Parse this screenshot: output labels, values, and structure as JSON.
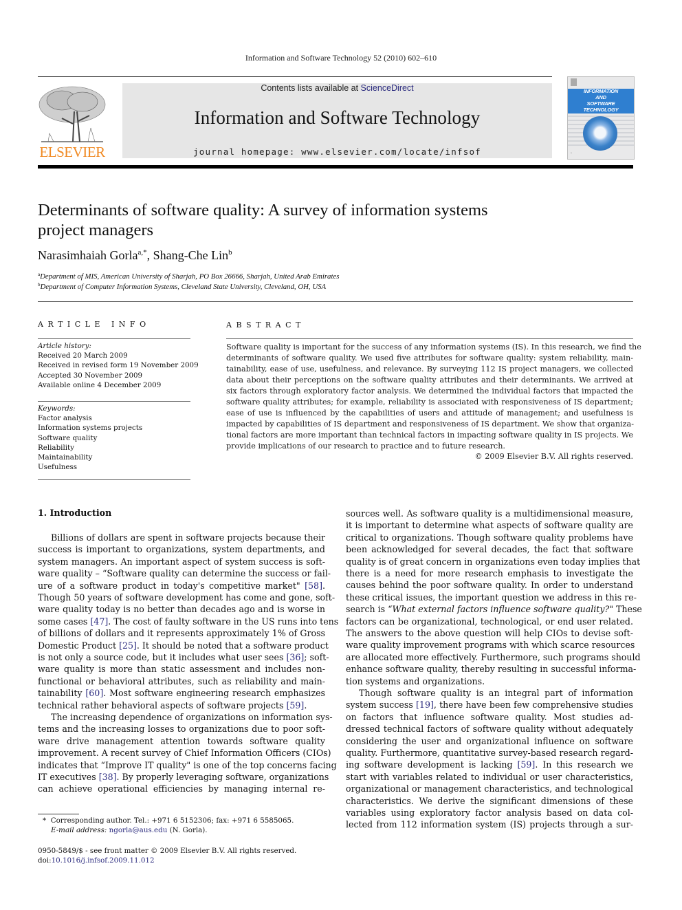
{
  "running_head": "Information and Software Technology 52 (2010) 602–610",
  "masthead": {
    "contents_prefix": "Contents lists available at ",
    "contents_link": "ScienceDirect",
    "journal_title": "Information and Software Technology",
    "homepage": "journal homepage: www.elsevier.com/locate/infsof",
    "publisher_logo_text": "ELSEVIER",
    "cover_lines": [
      "INFORMATION",
      "AND",
      "SOFTWARE",
      "TECHNOLOGY"
    ],
    "colors": {
      "elsevier_orange": "#f08a24",
      "link_blue": "#2a2a7e",
      "cover_blue": "#2f7fd0",
      "band_gray": "#e6e6e6"
    }
  },
  "article": {
    "title_line1": "Determinants of software quality: A survey of information systems",
    "title_line2": "project managers",
    "authors": [
      {
        "name": "Narasimhaiah Gorla",
        "sup": "a,*"
      },
      {
        "name": "Shang-Che Lin",
        "sup": "b"
      }
    ],
    "author_separator": ", ",
    "affiliations": [
      {
        "sup": "a",
        "text": "Department of MIS, American University of Sharjah, PO Box 26666, Sharjah, United Arab Emirates"
      },
      {
        "sup": "b",
        "text": "Department of Computer Information Systems, Cleveland State University, Cleveland, OH, USA"
      }
    ]
  },
  "article_info": {
    "heading": "ARTICLE INFO",
    "history_label": "Article history:",
    "history": [
      "Received 20 March 2009",
      "Received in revised form 19 November 2009",
      "Accepted 30 November 2009",
      "Available online 4 December 2009"
    ],
    "keywords_label": "Keywords:",
    "keywords": [
      "Factor analysis",
      "Information systems projects",
      "Software quality",
      "Reliability",
      "Maintainability",
      "Usefulness"
    ]
  },
  "abstract": {
    "heading": "ABSTRACT",
    "lines": [
      "Software quality is important for the success of any information systems (IS). In this research, we find the",
      "determinants of software quality. We used five attributes for software quality: system reliability, main-",
      "tainability, ease of use, usefulness, and relevance. By surveying 112 IS project managers, we collected",
      "data about their perceptions on the software quality attributes and their determinants. We arrived at",
      "six factors through exploratory factor analysis. We determined the individual factors that impacted the",
      "software quality attributes; for example, reliability is associated with responsiveness of IS department;",
      "ease of use is influenced by the capabilities of users and attitude of management; and usefulness is",
      "impacted by capabilities of IS department and responsiveness of IS department. We show that organiza-",
      "tional factors are more important than technical factors in impacting software quality in IS projects. We",
      "provide implications of our research to practice and to future research."
    ],
    "copyright": "© 2009 Elsevier B.V. All rights reserved."
  },
  "intro": {
    "heading": "1. Introduction",
    "col1": [
      {
        "t": "Billions of dollars are spent in software projects because their",
        "indent": true
      },
      {
        "t": "success is important to organizations, system departments, and"
      },
      {
        "t": "system managers. An important aspect of system success is soft-"
      },
      {
        "t": "ware quality – “Software quality can determine the success or fail-"
      },
      {
        "t": "ure of a software product in today's competitive market\" ",
        "cite": "[58]",
        "after": "."
      },
      {
        "t": "Though 50 years of software development has come and gone, soft-"
      },
      {
        "t": "ware quality today is no better than decades ago and is worse in"
      },
      {
        "t": "some cases ",
        "cite": "[47]",
        "after": ". The cost of faulty software in the US runs into tens"
      },
      {
        "t": "of billions of dollars and it represents approximately 1% of Gross"
      },
      {
        "t": "Domestic Product ",
        "cite": "[25]",
        "after": ". It should be noted that a software product"
      },
      {
        "t": "is not only a source code, but it includes what user sees ",
        "cite": "[36]",
        "after": "; soft-"
      },
      {
        "t": "ware quality is more than static assessment and includes non-"
      },
      {
        "t": "functional or behavioral attributes, such as reliability and main-"
      },
      {
        "t": "tainability ",
        "cite": "[60]",
        "after": ". Most software engineering research emphasizes"
      },
      {
        "t": "technical rather behavioral aspects of software projects ",
        "cite": "[59]",
        "after": ".",
        "last": true
      },
      {
        "t": "The increasing dependence of organizations on information sys-",
        "indent": true
      },
      {
        "t": "tems and the increasing losses to organizations due to poor soft-"
      },
      {
        "t": "ware drive management attention towards software quality"
      },
      {
        "t": "improvement. A recent survey of Chief Information Officers (CIOs)"
      },
      {
        "t": "indicates that “Improve IT quality\" is one of the top concerns facing"
      },
      {
        "t": "IT executives ",
        "cite": "[38]",
        "after": ". By properly leveraging software, organizations"
      },
      {
        "t": "can achieve operational efficiencies by managing internal re-"
      }
    ],
    "col2": [
      {
        "t": "sources well. As software quality is a multidimensional measure,"
      },
      {
        "t": "it is important to determine what aspects of software quality are"
      },
      {
        "t": "critical to organizations. Though software quality problems have"
      },
      {
        "t": "been acknowledged for several decades, the fact that software"
      },
      {
        "t": "quality is of great concern in organizations even today implies that"
      },
      {
        "t": "there is a need for more research emphasis to investigate the"
      },
      {
        "t": "causes behind the poor software quality. In order to understand"
      },
      {
        "t": "these critical issues, the important question we address in this re-"
      },
      {
        "t": "search is “",
        "em": "What external factors influence software quality?",
        "after": "\" These"
      },
      {
        "t": "factors can be organizational, technological, or end user related."
      },
      {
        "t": "The answers to the above question will help CIOs to devise soft-"
      },
      {
        "t": "ware quality improvement programs with which scarce resources"
      },
      {
        "t": "are allocated more effectively. Furthermore, such programs should"
      },
      {
        "t": "enhance software quality, thereby resulting in successful informa-"
      },
      {
        "t": "tion systems and organizations.",
        "last": true
      },
      {
        "t": "Though software quality is an integral part of information",
        "indent": true
      },
      {
        "t": "system success ",
        "cite": "[19]",
        "after": ", there have been few comprehensive studies"
      },
      {
        "t": "on factors that influence software quality. Most studies ad-"
      },
      {
        "t": "dressed technical factors of software quality without adequately"
      },
      {
        "t": "considering the user and organizational influence on software"
      },
      {
        "t": "quality. Furthermore, quantitative survey-based research regard-"
      },
      {
        "t": "ing software development is lacking ",
        "cite": "[59]",
        "after": ". In this research we"
      },
      {
        "t": "start with variables related to individual or user characteristics,"
      },
      {
        "t": "organizational or management characteristics, and technological"
      },
      {
        "t": "characteristics. We derive the significant dimensions of these"
      },
      {
        "t": "variables using exploratory factor analysis based on data col-"
      },
      {
        "t": "lected from 112 information system (IS) projects through a sur-"
      }
    ]
  },
  "footnotes": {
    "corresponding_marker": "*",
    "corresponding": "Corresponding author. Tel.: +971 6 5152306; fax: +971 6 5585065.",
    "email_label": "E-mail address:",
    "email": "ngorla@aus.edu",
    "email_after": " (N. Gorla).",
    "front_matter": "0950-5849/$ - see front matter © 2009 Elsevier B.V. All rights reserved.",
    "doi_label": "doi:",
    "doi": "10.1016/j.infsof.2009.11.012"
  }
}
